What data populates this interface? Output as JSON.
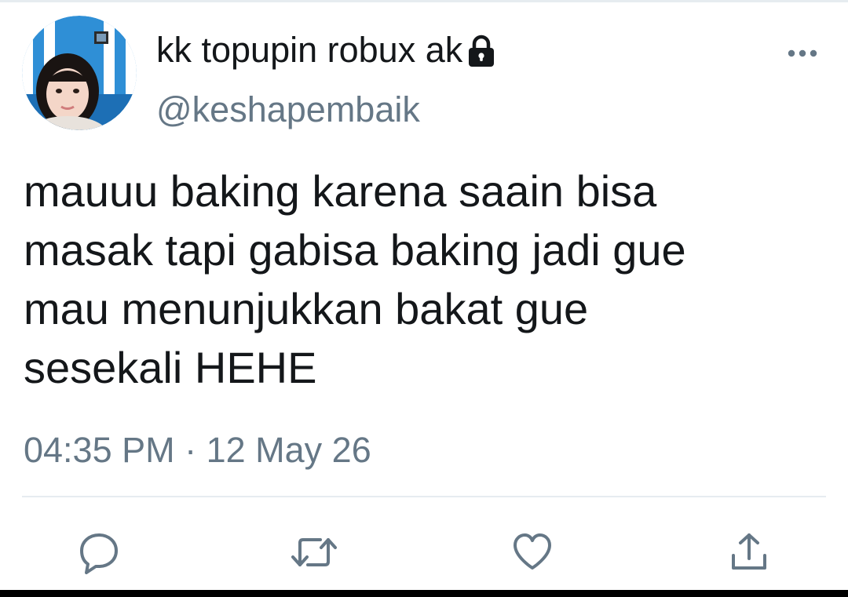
{
  "tweet": {
    "display_name": "kk topupin robux ak",
    "handle": "@keshapembaik",
    "text": "mauuu baking karena saain bisa\nmasak tapi gabisa baking jadi gue\nmau menunjukkan bakat gue\nsesekali HEHE",
    "timestamp": "04:35 PM · 12 May 26",
    "protected": true
  },
  "icons": {
    "lock": "lock-icon",
    "more": "more-icon",
    "reply": "reply-icon",
    "retweet": "retweet-icon",
    "like": "heart-icon",
    "share": "share-icon"
  },
  "colors": {
    "text_primary": "#14171a",
    "text_secondary": "#657786",
    "divider": "#e6ecf0",
    "action_icon": "#657786"
  }
}
